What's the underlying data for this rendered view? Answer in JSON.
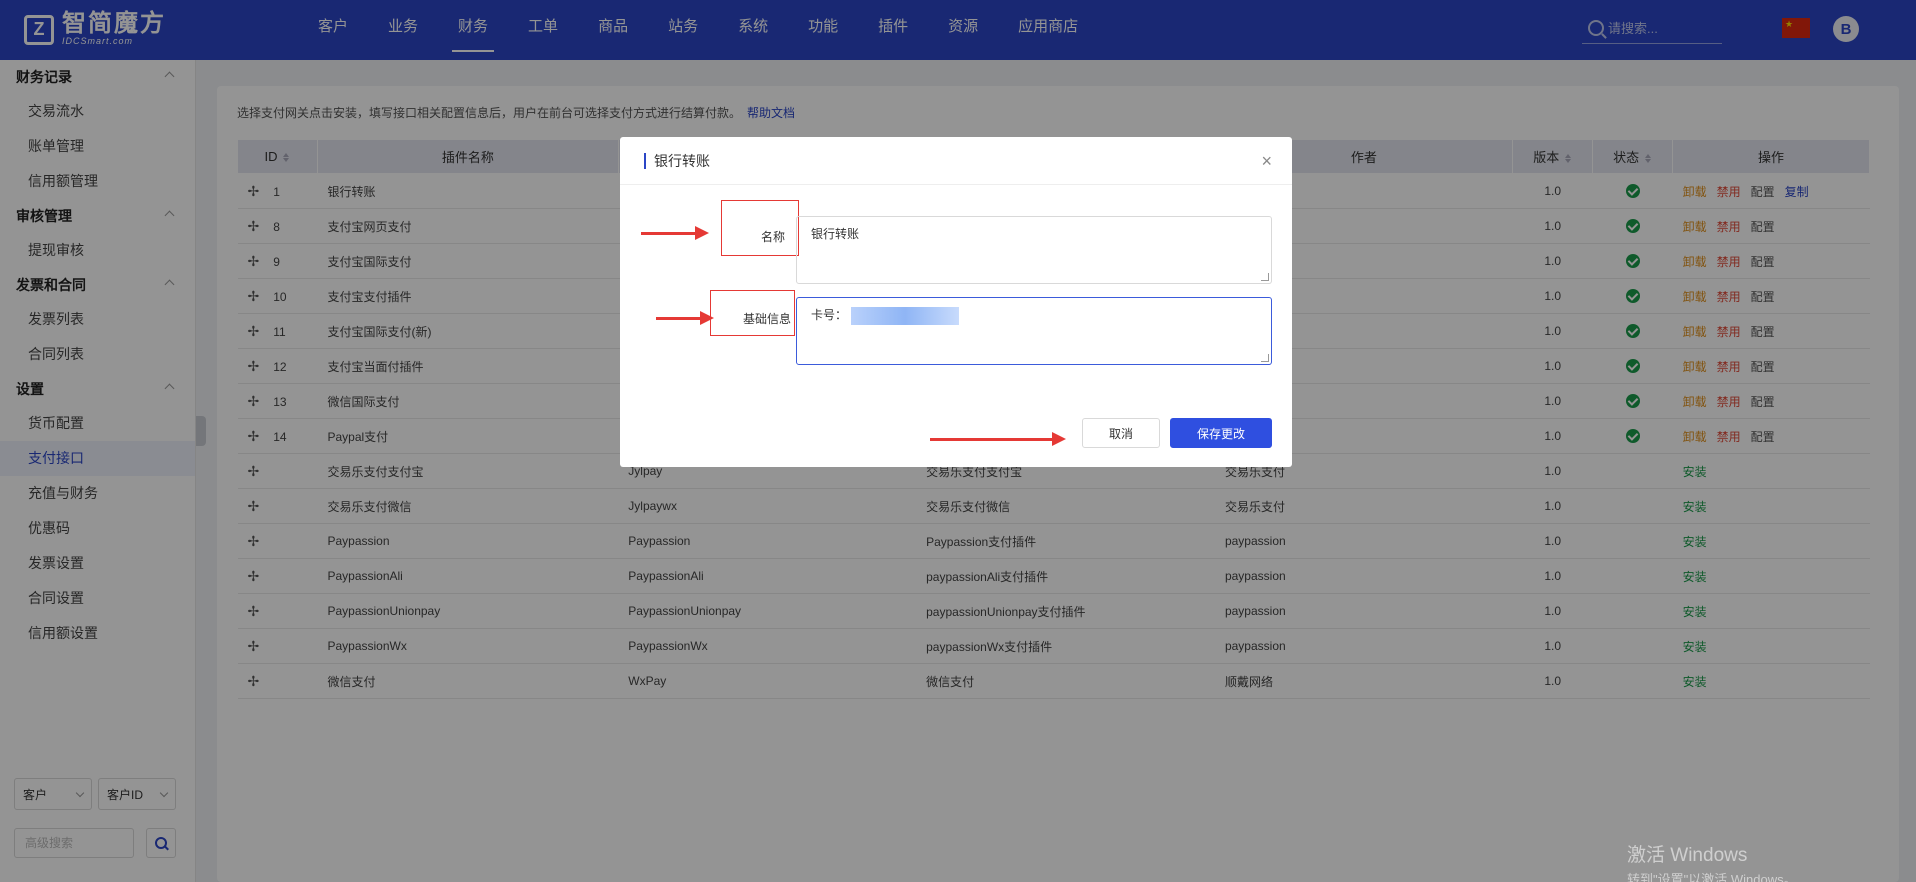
{
  "brand": {
    "logo_mark": "Z",
    "name": "智简魔方",
    "sub": "IDCSmart.com"
  },
  "nav": [
    "客户",
    "业务",
    "财务",
    "工单",
    "商品",
    "站务",
    "系统",
    "功能",
    "插件",
    "资源",
    "应用商店"
  ],
  "nav_active_index": 2,
  "search": {
    "placeholder": "请搜索..."
  },
  "user": {
    "avatar": "B"
  },
  "sidebar": {
    "groups": [
      {
        "title": "财务记录",
        "items": [
          "交易流水",
          "账单管理",
          "信用额管理"
        ]
      },
      {
        "title": "审核管理",
        "items": [
          "提现审核"
        ]
      },
      {
        "title": "发票和合同",
        "items": [
          "发票列表",
          "合同列表"
        ]
      },
      {
        "title": "设置",
        "items": [
          "货币配置",
          "支付接口",
          "充值与财务",
          "优惠码",
          "发票设置",
          "合同设置",
          "信用额设置"
        ]
      }
    ],
    "active_item": "支付接口",
    "filter": {
      "select1": "客户",
      "select2": "客户ID",
      "input_placeholder": "高级搜索"
    }
  },
  "page": {
    "hint": "选择支付网关点击安装，填写接口相关配置信息后，用户在前台可选择支付方式进行结算付款。",
    "help_link": "帮助文档"
  },
  "table": {
    "headers": [
      "ID",
      "插件名称",
      "",
      "",
      "作者",
      "版本",
      "状态",
      "操作"
    ],
    "installed_ops": [
      "卸载",
      "禁用",
      "配置"
    ],
    "copy_op": "复制",
    "install_op": "安装",
    "rows": [
      {
        "id": "1",
        "name": "银行转账",
        "code": "",
        "desc": "",
        "author": "",
        "version": "1.0",
        "installed": true,
        "copy": true
      },
      {
        "id": "8",
        "name": "支付宝网页支付",
        "code": "",
        "desc": "",
        "author": "",
        "version": "1.0",
        "installed": true
      },
      {
        "id": "9",
        "name": "支付宝国际支付",
        "code": "",
        "desc": "",
        "author": "",
        "version": "1.0",
        "installed": true
      },
      {
        "id": "10",
        "name": "支付宝支付插件",
        "code": "",
        "desc": "",
        "author": "",
        "version": "1.0",
        "installed": true
      },
      {
        "id": "11",
        "name": "支付宝国际支付(新)",
        "code": "",
        "desc": "",
        "author": "",
        "version": "1.0",
        "installed": true
      },
      {
        "id": "12",
        "name": "支付宝当面付插件",
        "code": "",
        "desc": "",
        "author": "",
        "version": "1.0",
        "installed": true
      },
      {
        "id": "13",
        "name": "微信国际支付",
        "code": "",
        "desc": "",
        "author": "",
        "version": "1.0",
        "installed": true
      },
      {
        "id": "14",
        "name": "Paypal支付",
        "code": "",
        "desc": "",
        "author": "",
        "version": "1.0",
        "installed": true
      },
      {
        "id": "",
        "name": "交易乐支付支付宝",
        "code": "Jylpay",
        "desc": "交易乐支付支付宝",
        "author": "交易乐支付",
        "version": "1.0",
        "installed": false
      },
      {
        "id": "",
        "name": "交易乐支付微信",
        "code": "Jylpaywx",
        "desc": "交易乐支付微信",
        "author": "交易乐支付",
        "version": "1.0",
        "installed": false
      },
      {
        "id": "",
        "name": "Paypassion",
        "code": "Paypassion",
        "desc": "Paypassion支付插件",
        "author": "paypassion",
        "version": "1.0",
        "installed": false
      },
      {
        "id": "",
        "name": "PaypassionAli",
        "code": "PaypassionAli",
        "desc": "paypassionAli支付插件",
        "author": "paypassion",
        "version": "1.0",
        "installed": false
      },
      {
        "id": "",
        "name": "PaypassionUnionpay",
        "code": "PaypassionUnionpay",
        "desc": "paypassionUnionpay支付插件",
        "author": "paypassion",
        "version": "1.0",
        "installed": false
      },
      {
        "id": "",
        "name": "PaypassionWx",
        "code": "PaypassionWx",
        "desc": "paypassionWx支付插件",
        "author": "paypassion",
        "version": "1.0",
        "installed": false
      },
      {
        "id": "",
        "name": "微信支付",
        "code": "WxPay",
        "desc": "微信支付",
        "author": "顺戴网络",
        "version": "1.0",
        "installed": false
      }
    ]
  },
  "modal": {
    "title": "银行转账",
    "close": "×",
    "name_label": "名称",
    "name_value": "银行转账",
    "info_label": "基础信息",
    "info_value": "卡号：",
    "cancel": "取消",
    "save": "保存更改"
  },
  "watermark": {
    "line1": "激活 Windows",
    "line2": "转到\"设置\"以激活 Windows。"
  },
  "colors": {
    "primary": "#2b46c6",
    "success": "#1b9b4a",
    "annotation": "#e53935"
  }
}
